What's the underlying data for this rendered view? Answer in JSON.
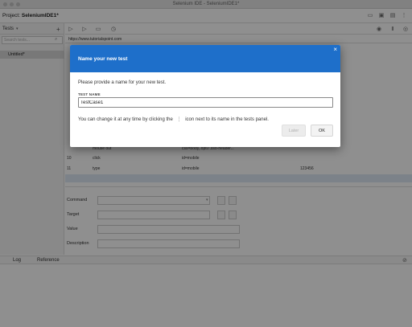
{
  "window": {
    "title": "Selenium IDE - SeleniumIDE1*"
  },
  "project": {
    "label": "Project:",
    "name": "SeleniumIDE1*"
  },
  "sidebar": {
    "tests_label": "Tests",
    "search_placeholder": "Search tests...",
    "tests": [
      {
        "name": "Untitled*"
      }
    ]
  },
  "url_bar": {
    "value": "https://www.tutorialspoint.com"
  },
  "commands": [
    {
      "num": "",
      "command": "mouse out",
      "target": "css=body,.opti7.sso-header...",
      "value": ""
    },
    {
      "num": "10",
      "command": "click",
      "target": "id=mobile",
      "value": ""
    },
    {
      "num": "11",
      "command": "type",
      "target": "id=mobile",
      "value": "123456"
    }
  ],
  "editor": {
    "command_label": "Command",
    "target_label": "Target",
    "value_label": "Value",
    "description_label": "Description"
  },
  "bottom_tabs": {
    "log": "Log",
    "reference": "Reference"
  },
  "dialog": {
    "title": "Name your new test",
    "prompt": "Please provide a name for your new test.",
    "field_label": "TEST NAME",
    "input_value": "TestCase1",
    "hint_before": "You can change it at any time by clicking the",
    "hint_icon": "⋮",
    "hint_after": "icon next to its name in the tests panel.",
    "later_label": "Later",
    "ok_label": "OK",
    "close_glyph": "×"
  },
  "colors": {
    "dialog_header": "#1e6fca"
  }
}
